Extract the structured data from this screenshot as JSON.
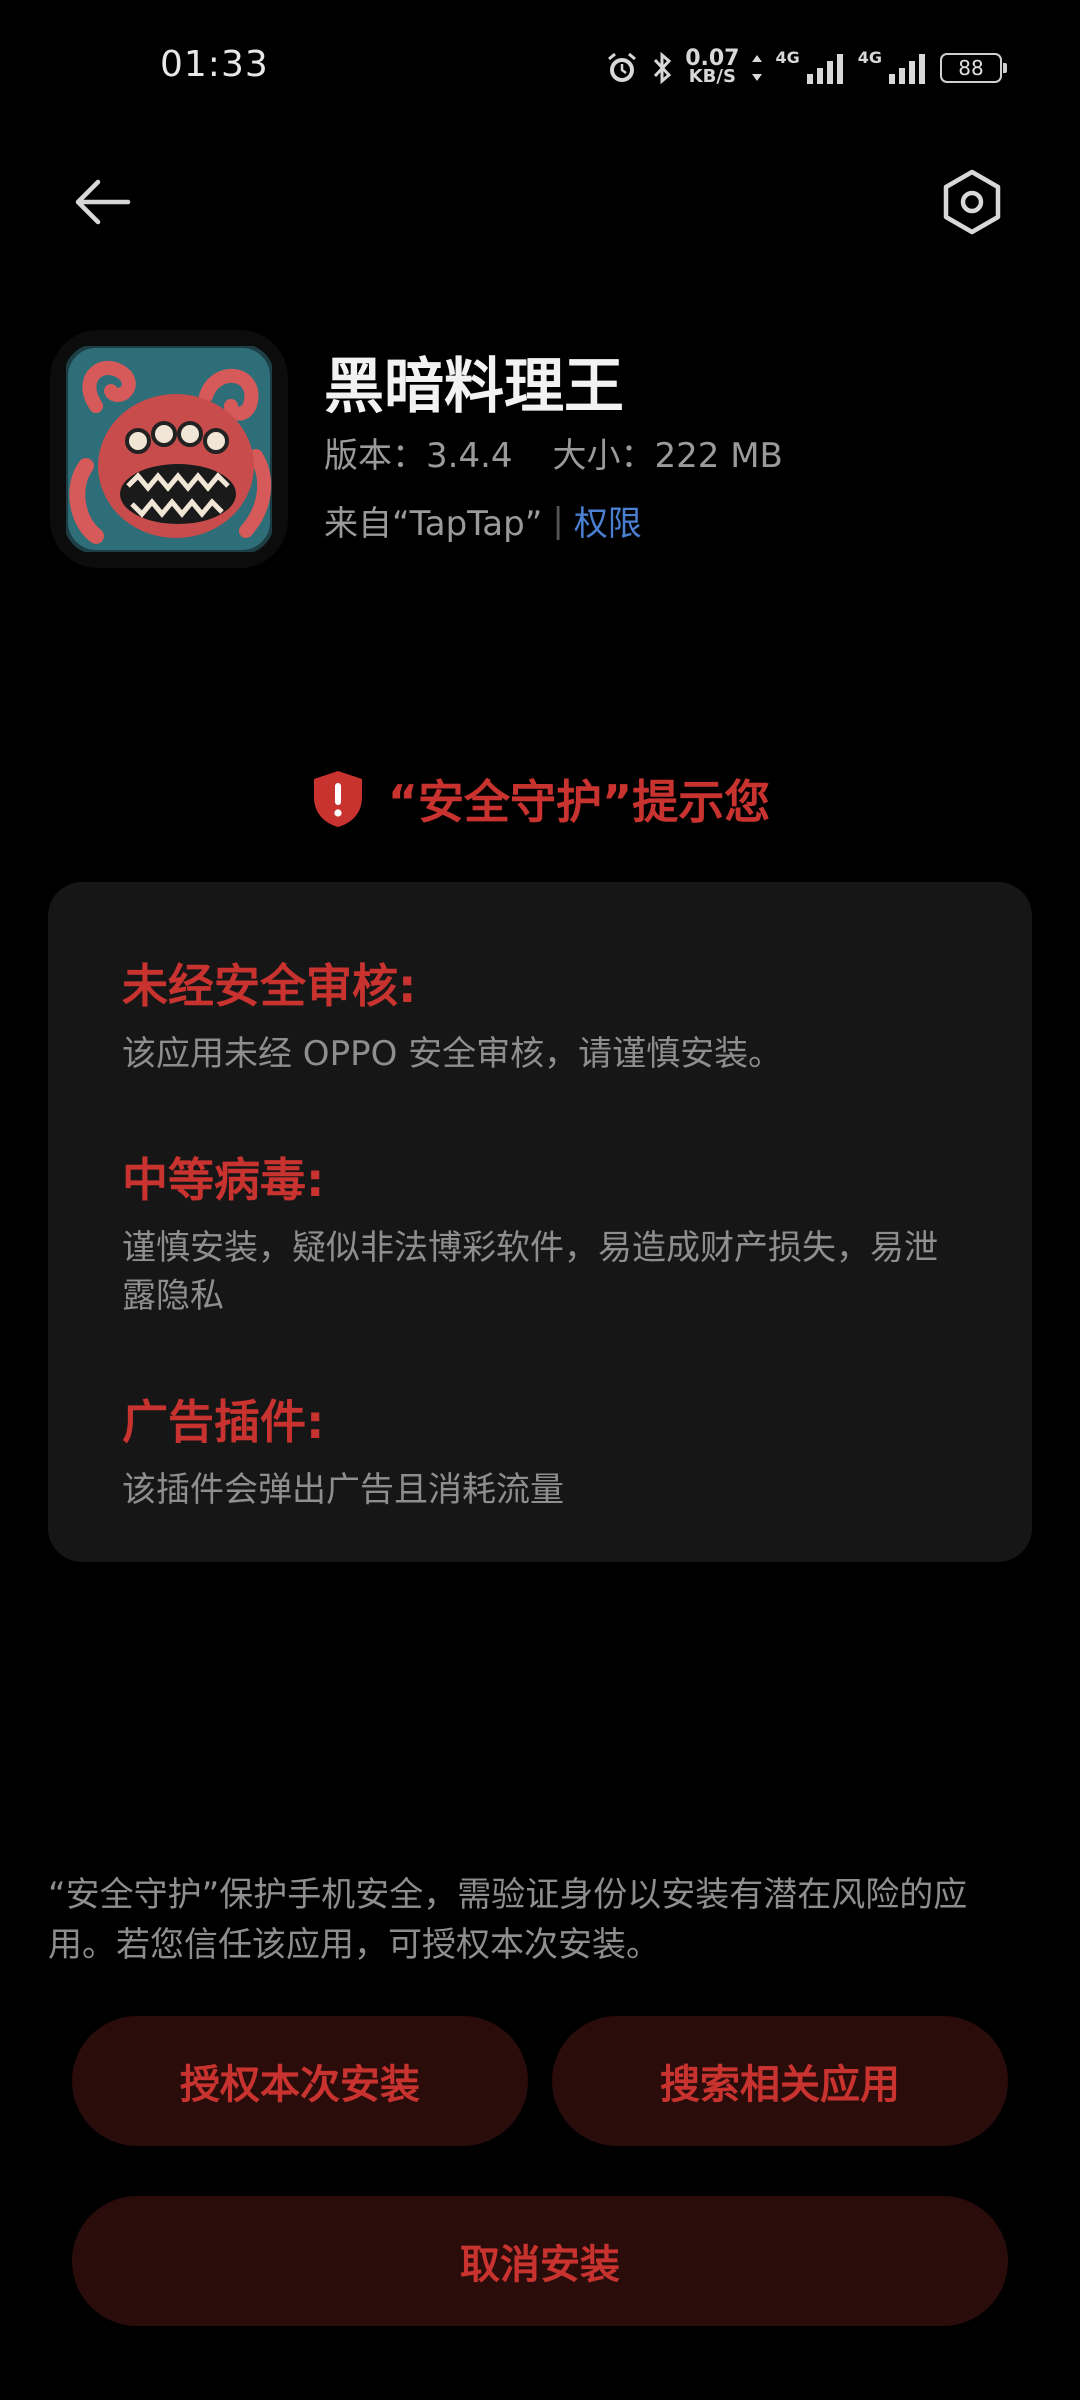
{
  "status_bar": {
    "time": "01:33",
    "speed_value": "0.07",
    "speed_unit": "KB/S",
    "network_1": "4G",
    "network_2": "4G",
    "battery": "88",
    "icons": [
      "alarm-icon",
      "bluetooth-icon",
      "data-arrows-icon",
      "signal-icon",
      "signal-icon",
      "battery-icon"
    ]
  },
  "header": {
    "back_icon": "back-arrow-icon",
    "settings_icon": "settings-hexagon-icon"
  },
  "app": {
    "name": "黑暗料理王",
    "version": "版本：3.4.4",
    "size": "大小：222 MB",
    "source": "来自“TapTap”",
    "separator": "|",
    "permissions_link": "权限"
  },
  "warning": {
    "title": "“安全守护”提示您",
    "icon": "shield-alert-icon"
  },
  "risks": [
    {
      "title": "未经安全审核:",
      "desc": "该应用未经 OPPO 安全审核，请谨慎安装。"
    },
    {
      "title": "中等病毒:",
      "desc": "谨慎安装，疑似非法博彩软件，易造成财产损失，易泄露隐私"
    },
    {
      "title": "广告插件:",
      "desc": "该插件会弹出广告且消耗流量"
    }
  ],
  "footer": {
    "note": "“安全守护”保护手机安全，需验证身份以安装有潜在风险的应用。若您信任该应用，可授权本次安装。",
    "authorize_label": "授权本次安装",
    "search_label": "搜索相关应用",
    "cancel_label": "取消安装"
  },
  "colors": {
    "background": "#000000",
    "card": "#161616",
    "accent_red": "#c9332f",
    "button_bg": "#2a0d0b",
    "link_blue": "#4a7fd1",
    "muted_text": "#8e8e8e"
  }
}
